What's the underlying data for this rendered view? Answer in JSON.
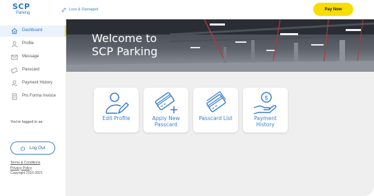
{
  "header": {
    "logo_mark": "SCP",
    "logo_sub": "Parking",
    "loss_link": "Loss & Damaged",
    "pay_now": "Pay Now"
  },
  "sidebar": {
    "items": [
      {
        "label": "Dashboard",
        "icon": "home-icon",
        "active": true
      },
      {
        "label": "Profile",
        "icon": "user-icon"
      },
      {
        "label": "Message",
        "icon": "mail-icon"
      },
      {
        "label": "Passcard",
        "icon": "card-icon"
      },
      {
        "label": "Payment History",
        "icon": "payment-icon"
      },
      {
        "label": "Pro Forma Invoice",
        "icon": "invoice-icon"
      }
    ],
    "logged_in": "You're logged in as:",
    "logout": "Log Out",
    "terms": "Terms & Conditions",
    "privacy": "Privacy Policy",
    "copyright": "Copyright 2010-2021"
  },
  "hero": {
    "line1": "Welcome to",
    "line2": "SCP Parking"
  },
  "tiles": [
    {
      "label_lines": [
        "Edit Profile"
      ],
      "icon": "edit-profile-icon"
    },
    {
      "label_lines": [
        "Apply New",
        "Passcard"
      ],
      "icon": "add-card-icon"
    },
    {
      "label_lines": [
        "Passcard List"
      ],
      "icon": "card-list-icon"
    },
    {
      "label_lines": [
        "Payment",
        "History"
      ],
      "icon": "payment-hand-icon"
    }
  ],
  "colors": {
    "accent": "#2f76c9",
    "pay_button": "#f7dd00",
    "background": "#efefef"
  }
}
